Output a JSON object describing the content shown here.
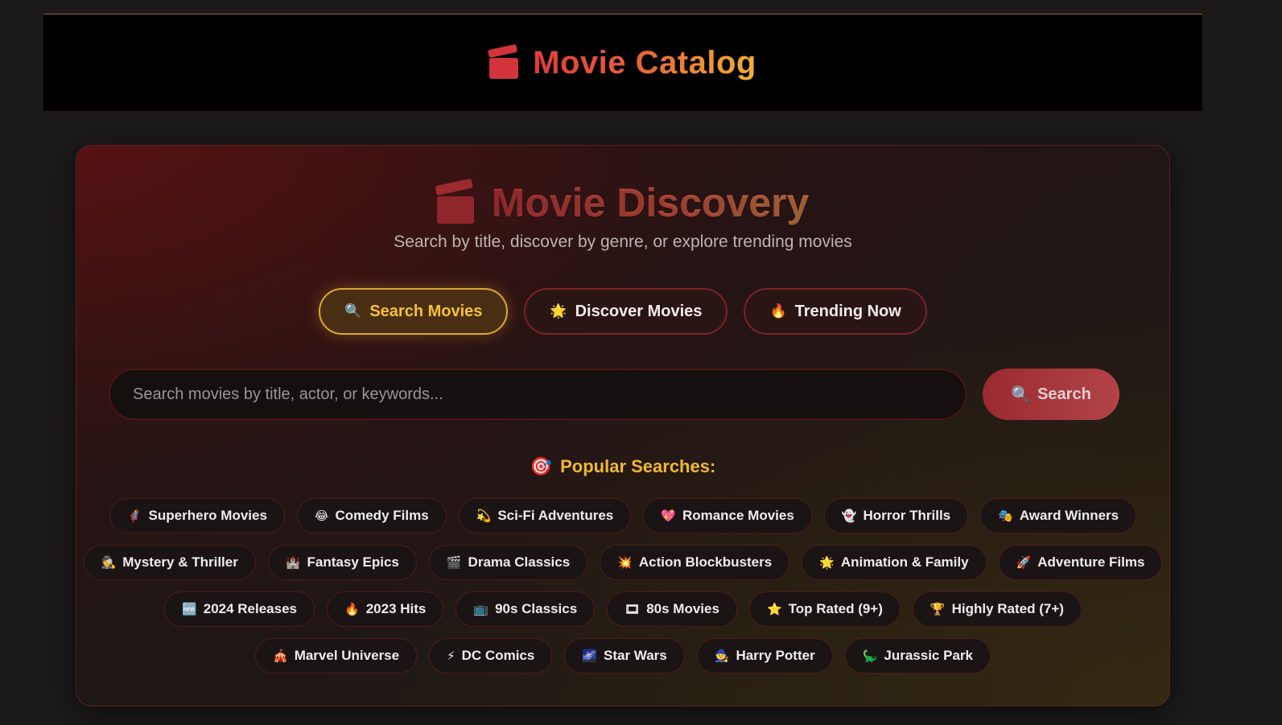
{
  "header": {
    "title": "Movie Catalog",
    "icon": "clapper-icon"
  },
  "hero": {
    "title": "Movie Discovery",
    "subtitle": "Search by title, discover by genre, or explore trending movies"
  },
  "modes": [
    {
      "icon": "🔍",
      "label": "Search Movies",
      "active": true
    },
    {
      "icon": "🌟",
      "label": "Discover Movies",
      "active": false
    },
    {
      "icon": "🔥",
      "label": "Trending Now",
      "active": false
    }
  ],
  "search": {
    "placeholder": "Search movies by title, actor, or keywords...",
    "value": "",
    "button_icon": "🔍",
    "button_label": "Search"
  },
  "popular": {
    "icon": "🎯",
    "heading": "Popular Searches:",
    "rows": [
      [
        {
          "icon": "🦸",
          "label": "Superhero Movies"
        },
        {
          "icon": "😂",
          "label": "Comedy Films"
        },
        {
          "icon": "💫",
          "label": "Sci-Fi Adventures"
        },
        {
          "icon": "💖",
          "label": "Romance Movies"
        },
        {
          "icon": "👻",
          "label": "Horror Thrills"
        },
        {
          "icon": "🎭",
          "label": "Award Winners"
        }
      ],
      [
        {
          "icon": "🕵",
          "label": "Mystery & Thriller"
        },
        {
          "icon": "🏰",
          "label": "Fantasy Epics"
        },
        {
          "icon": "🎬",
          "label": "Drama Classics"
        },
        {
          "icon": "💥",
          "label": "Action Blockbusters"
        },
        {
          "icon": "🌟",
          "label": "Animation & Family"
        },
        {
          "icon": "🚀",
          "label": "Adventure Films"
        }
      ],
      [
        {
          "icon": "🆕",
          "label": "2024 Releases"
        },
        {
          "icon": "🔥",
          "label": "2023 Hits"
        },
        {
          "icon": "📺",
          "label": "90s Classics"
        },
        {
          "icon": "🎞",
          "label": "80s Movies"
        },
        {
          "icon": "⭐",
          "label": "Top Rated (9+)"
        },
        {
          "icon": "🏆",
          "label": "Highly Rated (7+)"
        }
      ],
      [
        {
          "icon": "🎪",
          "label": "Marvel Universe"
        },
        {
          "icon": "⚡",
          "label": "DC Comics"
        },
        {
          "icon": "🌌",
          "label": "Star Wars"
        },
        {
          "icon": "🧙",
          "label": "Harry Potter"
        },
        {
          "icon": "🦕",
          "label": "Jurassic Park"
        }
      ]
    ]
  }
}
